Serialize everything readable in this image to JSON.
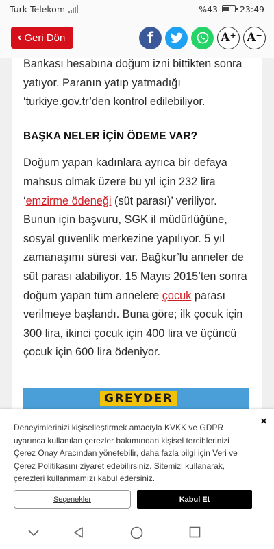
{
  "status_bar": {
    "carrier": "Turk Telekom",
    "battery": "%43",
    "battery_level": 0.43,
    "time": "23:49"
  },
  "header": {
    "back_label": "Geri Dön",
    "share": {
      "facebook": "f",
      "whatsapp": "",
      "font_up": "A",
      "font_up_sup": "+",
      "font_down": "A",
      "font_down_sup": "−"
    }
  },
  "article": {
    "intro": "Bankası hesabına doğum izni bittikten sonra yatıyor. Paranın yatıp yatmadığı ‘turkiye.gov.tr’den kontrol edilebiliyor.",
    "heading": "BAŞKA NELER İÇİN ÖDEME VAR?",
    "p1_before": "Doğum yapan kadınlara ayrıca bir defaya mahsus olmak üzere bu yıl için 232 lira ‘",
    "p1_link": "emzirme ödeneği",
    "p1_middle": " (süt parası)’ veriliyor. Bunun için başvuru, SGK il müdürlüğüne, sosyal güvenlik merkezine yapılıyor. 5 yıl zamanaşımı süresi var. Bağkur’lu anneler de süt parası alabiliyor. 15 Mayıs 2015’ten sonra doğum yapan tüm annelere ",
    "p1_link2": "çocuk",
    "p1_after": " parası verilmeye başlandı. Buna göre; ilk çocuk için 300 lira, ikinci çocuk için 400 lira ve üçüncü çocuk için 600 lira ödeniyor."
  },
  "ad": {
    "label": "GREYDER",
    "color": "#4a9fd8"
  },
  "cookie": {
    "text": "Deneyimlerinizi kişiselleştirmek amacıyla KVKK ve GDPR uyarınca kullanılan çerezler bakımından kişisel tercihlerinizi Çerez Onay Aracından yönetebilir, daha fazla bilgi için Veri ve Çerez Politikasını ziyaret edebilirsiniz. Sitemizi kullanarak, çerezleri kullanmamızı kabul edersiniz.",
    "close": "×",
    "options_label": "Seçenekler",
    "accept_label": "Kabul Et"
  },
  "nav": {
    "icons": [
      "chevron-down-icon",
      "back-triangle-icon",
      "home-circle-icon",
      "recents-square-icon"
    ]
  },
  "colors": {
    "accent": "#d6101a",
    "link": "#d01e26",
    "facebook": "#3b5998",
    "twitter": "#1da1f2",
    "whatsapp": "#25d366"
  }
}
